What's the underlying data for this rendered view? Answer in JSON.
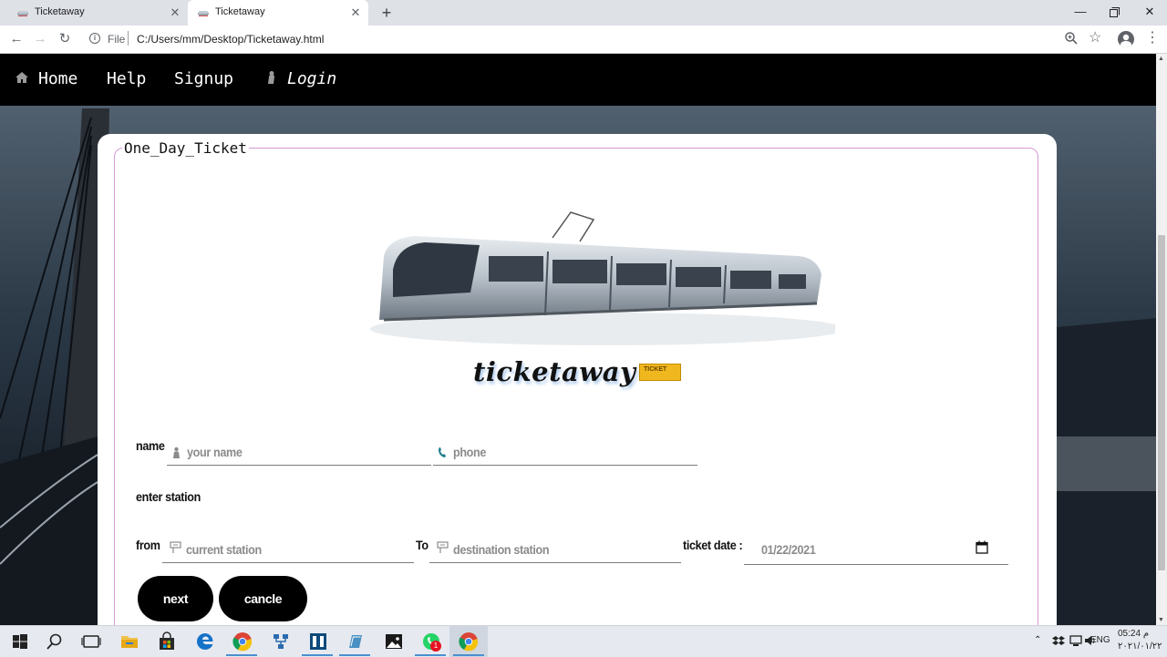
{
  "browser": {
    "tabs": [
      {
        "label": "Ticketaway",
        "active": false
      },
      {
        "label": "Ticketaway",
        "active": true
      }
    ],
    "scheme_label": "File",
    "url": "C:/Users/mm/Desktop/Ticketaway.html"
  },
  "site_nav": {
    "home": "Home",
    "help": "Help",
    "signup": "Signup",
    "login": "Login"
  },
  "form": {
    "legend": "One_Day_Ticket",
    "logo_text": "ticketaway",
    "badge_text": "TICKET",
    "name_label": "name",
    "name_placeholder": "your name",
    "phone_placeholder": "phone",
    "station_heading": "enter station",
    "from_label": "from",
    "from_placeholder": "current station",
    "to_label": "To",
    "to_placeholder": "destination station",
    "date_label": "ticket date :",
    "date_value": "01/22/2021",
    "next_button": "next",
    "cancel_button": "cancle"
  },
  "taskbar": {
    "language": "ENG",
    "time": "05:24 م",
    "date": "٢٠٢١/٠١/٢٢",
    "whatsapp_badge": "1"
  },
  "colors": {
    "accent": "#d79ad7",
    "nav_bg": "#000000",
    "button_bg": "#000000"
  }
}
